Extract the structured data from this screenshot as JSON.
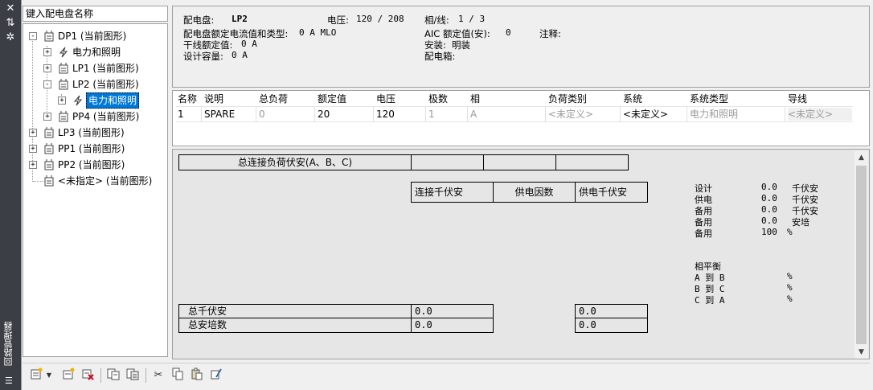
{
  "sidebar": {
    "title": "回路管理器",
    "buttons": [
      "close",
      "pin",
      "settings"
    ]
  },
  "search": {
    "placeholder": "键入配电盘名称"
  },
  "tree": [
    {
      "label": "DP1 (当前图形)",
      "icon": "panel-icon",
      "expander": "-"
    },
    {
      "label": "电力和照明",
      "icon": "power-icon",
      "expander": "+"
    },
    {
      "label": "LP1 (当前图形)",
      "icon": "panel-icon",
      "expander": "+"
    },
    {
      "label": "LP2 (当前图形)",
      "icon": "panel-icon",
      "expander": "-"
    },
    {
      "label": "电力和照明",
      "icon": "power-icon",
      "expander": "+",
      "selected": true
    },
    {
      "label": "PP4 (当前图形)",
      "icon": "panel-icon",
      "expander": "+"
    },
    {
      "label": "LP3 (当前图形)",
      "icon": "panel-icon",
      "expander": "+"
    },
    {
      "label": "PP1 (当前图形)",
      "icon": "panel-icon",
      "expander": "+"
    },
    {
      "label": "PP2 (当前图形)",
      "icon": "panel-icon",
      "expander": "+"
    },
    {
      "label": "<未指定> (当前图形)",
      "icon": "panel-icon",
      "expander": ""
    }
  ],
  "info": {
    "panel_label": "配电盘:",
    "panel_value": "LP2",
    "voltage_label": "电压:",
    "voltage_value": "120 / 208",
    "phase_label": "相/线:",
    "phase_value": "1 / 3",
    "rating_label": "配电盘额定电流值和类型:",
    "rating_value": "0 A MLO",
    "aic_label": "AIC 额定值(安):",
    "aic_value": "0",
    "notes_label": "注释:",
    "feeder_label": "干线额定值:",
    "feeder_value": "0 A",
    "mount_label": "安装:",
    "mount_value": "明装",
    "design_label": "设计容量:",
    "design_value": "0 A",
    "enclosure_label": "配电箱:"
  },
  "grid": {
    "headers": [
      "名称",
      "说明",
      "总负荷",
      "额定值",
      "电压",
      "极数",
      "相",
      "负荷类别",
      "系统",
      "系统类型",
      "导线"
    ],
    "row": [
      "1",
      "SPARE",
      "0",
      "20",
      "120",
      "1",
      "A",
      "<未定义>",
      "<未定义>",
      "电力和照明",
      "<未定义>"
    ]
  },
  "summary": {
    "connected_header": "总连接负荷伏安(A、B、C)",
    "col_connected_kva": "连接千伏安",
    "col_demand_factor": "供电因数",
    "col_demand_kva": "供电千伏安",
    "total_kva_label": "总千伏安",
    "total_kva_connected": "0.0",
    "total_kva_demand": "0.0",
    "total_amps_label": "总安培数",
    "total_amps_connected": "0.0",
    "total_amps_demand": "0.0",
    "stats": [
      {
        "label": "设计",
        "value": "0.0",
        "unit": "千伏安"
      },
      {
        "label": "供电",
        "value": "0.0",
        "unit": "千伏安"
      },
      {
        "label": "备用",
        "value": "0.0",
        "unit": "千伏安"
      },
      {
        "label": "备用",
        "value": "0.0",
        "unit": "安培"
      },
      {
        "label": "备用",
        "value": "100",
        "unit": "%"
      }
    ],
    "balance_title": "相平衡",
    "balance": [
      {
        "label": "A 到 B",
        "unit": "%"
      },
      {
        "label": "B 到 C",
        "unit": "%"
      },
      {
        "label": "C 到 A",
        "unit": "%"
      }
    ]
  },
  "toolbar": {
    "buttons": [
      "new-panel-icon",
      "dropdown-icon",
      "new-circuit-icon",
      "delete-icon",
      "copy-panel-icon",
      "paste-panel-icon",
      "cut-icon",
      "copy-icon",
      "paste-icon",
      "properties-icon"
    ]
  }
}
